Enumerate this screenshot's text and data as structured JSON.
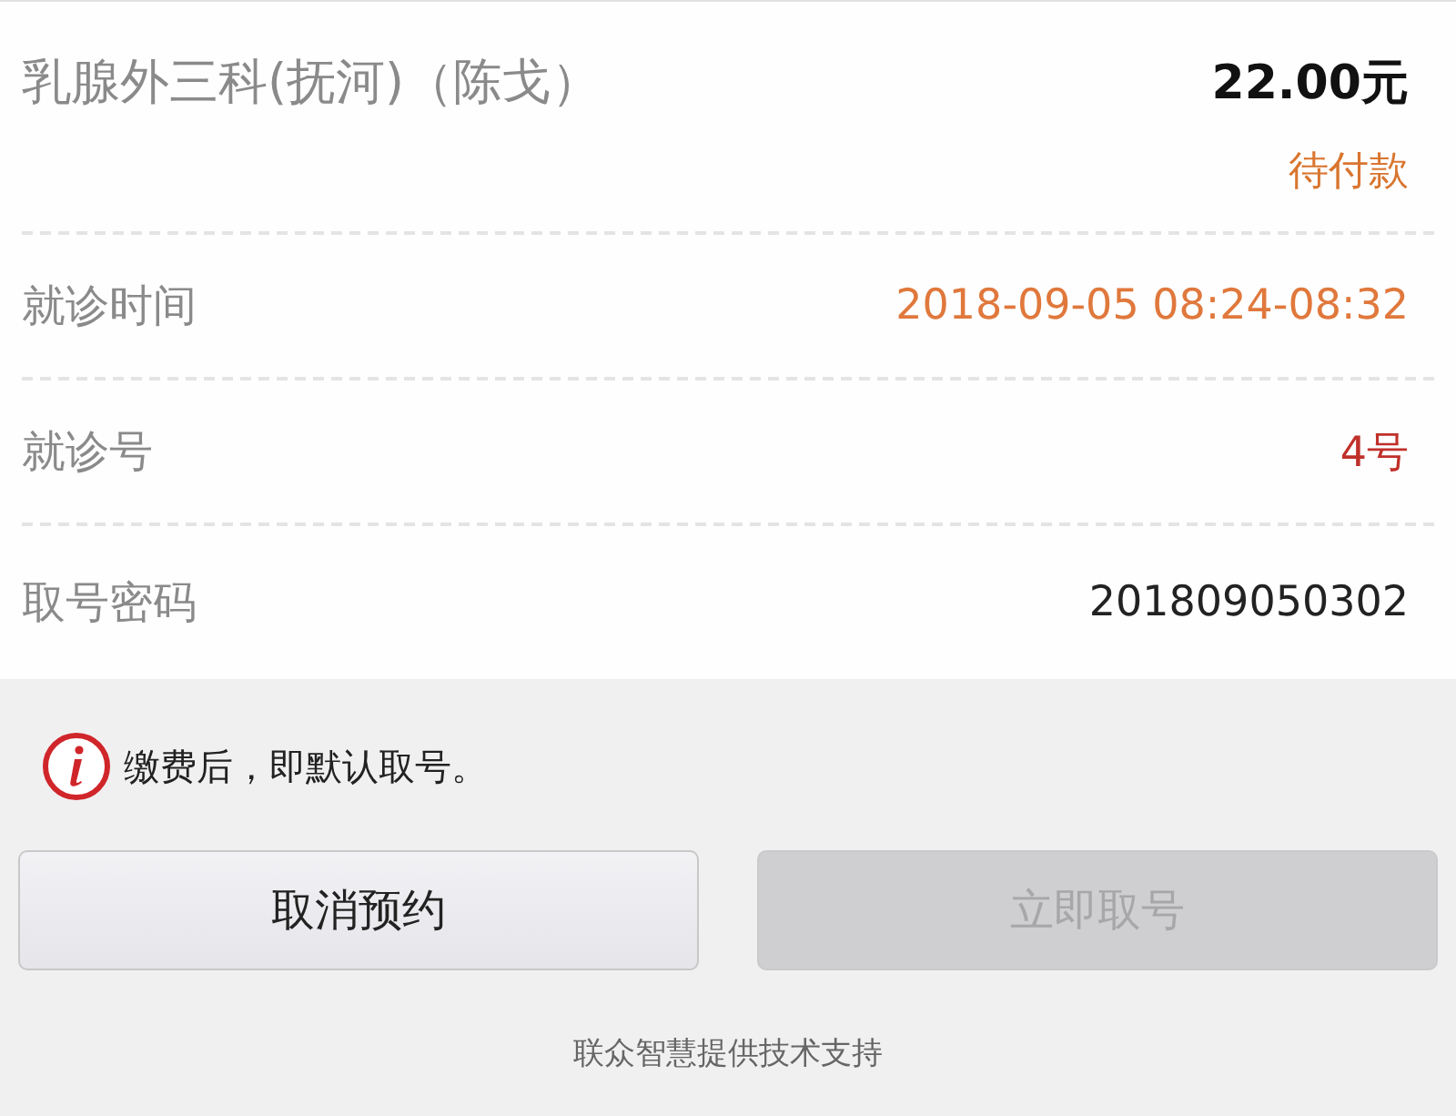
{
  "order": {
    "title": "乳腺外三科(抚河)（陈戈）",
    "amount": "22.00元",
    "status": "待付款"
  },
  "details": [
    {
      "label": "就诊时间",
      "value": "2018-09-05 08:24-08:32",
      "color": "#e0783c"
    },
    {
      "label": "就诊号",
      "value": "4号",
      "color": "#c0302a"
    },
    {
      "label": "取号密码",
      "value": "201809050302",
      "color": "#222222"
    }
  ],
  "notice": "缴费后，即默认取号。",
  "buttons": [
    {
      "label": "取消预约",
      "disabled": false
    },
    {
      "label": "立即取号",
      "disabled": true
    }
  ],
  "footer": "联众智慧提供技术支持"
}
